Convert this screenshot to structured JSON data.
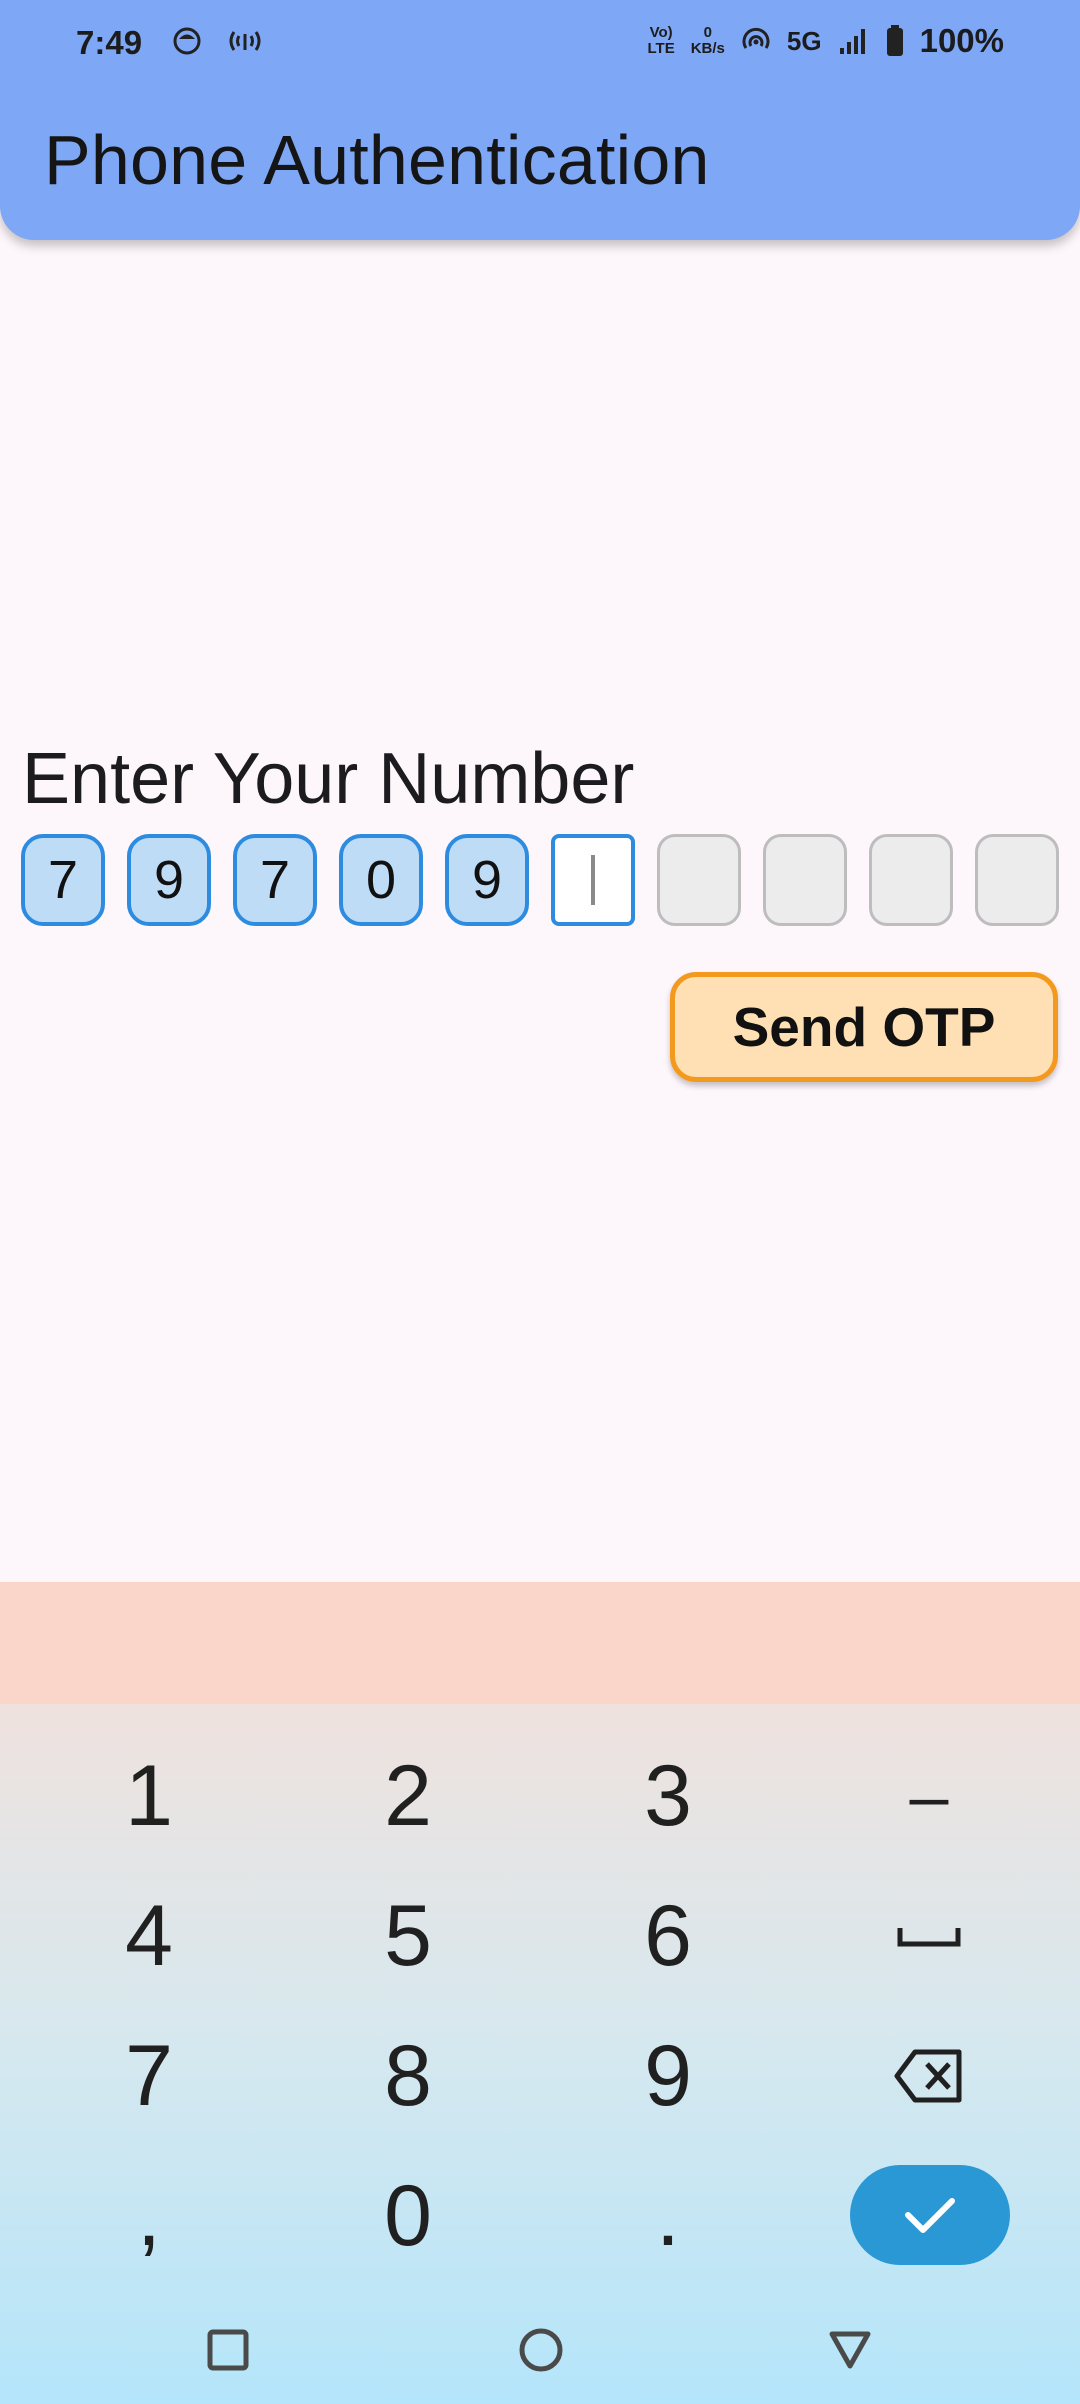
{
  "status_bar": {
    "time": "7:49",
    "volte_top": "Vo)",
    "volte_bottom": "LTE",
    "speed_value": "0",
    "speed_unit": "KB/s",
    "network": "5G",
    "battery": "100%"
  },
  "header": {
    "title": "Phone Authentication"
  },
  "main": {
    "prompt": "Enter Your Number",
    "digits": [
      "7",
      "9",
      "7",
      "0",
      "9"
    ],
    "send_button": "Send OTP"
  },
  "keyboard": {
    "keys": {
      "k1": "1",
      "k2": "2",
      "k3": "3",
      "dash": "–",
      "k4": "4",
      "k5": "5",
      "k6": "6",
      "space": "␣",
      "k7": "7",
      "k8": "8",
      "k9": "9",
      "comma": ",",
      "k0": "0",
      "period": "."
    },
    "icons": {
      "backspace": "backspace-icon",
      "done": "check-icon"
    }
  },
  "colors": {
    "appbar": "#7ea7f5",
    "digit_border": "#2e8ce0",
    "digit_fill": "#bfdcf7",
    "button_border": "#f39a1e",
    "button_fill": "#ffdfb4",
    "done_key": "#2a98d5"
  }
}
